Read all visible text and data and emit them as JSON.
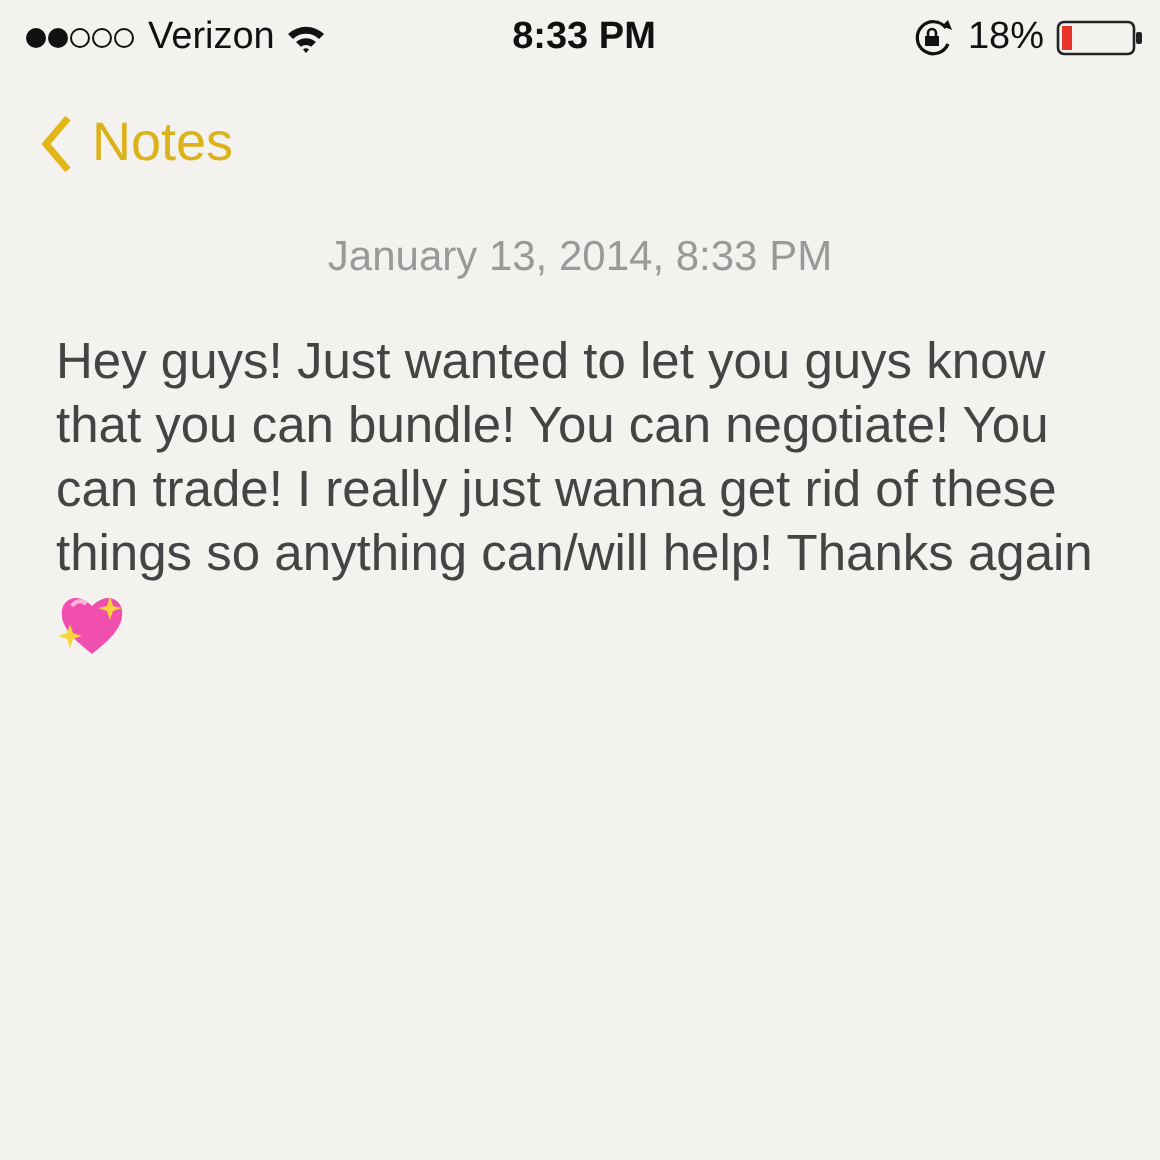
{
  "status_bar": {
    "carrier": "Verizon",
    "time": "8:33 PM",
    "battery": "18%"
  },
  "nav": {
    "back_label": "Notes"
  },
  "note": {
    "date": "January 13, 2014, 8:33 PM",
    "body": "Hey guys! Just wanted to let you guys know that you can bundle! You can negotiate! You can trade! I really just wanna get rid of these things so anything can/will help! Thanks again"
  }
}
